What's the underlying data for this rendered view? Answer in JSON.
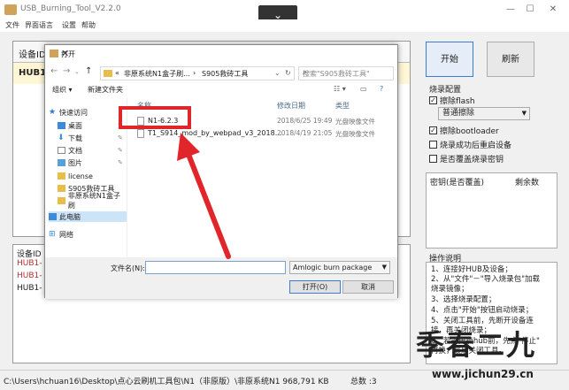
{
  "app": {
    "title": "USB_Burning_Tool_V2.2.0",
    "collapse_icon": "⌄",
    "min_icon": "—",
    "max_icon": "☐",
    "close_icon": "✕"
  },
  "menu": [
    "文件",
    "界面语言",
    "设置",
    "帮助"
  ],
  "device_panel": {
    "header": "设备ID",
    "row1": "HUB1"
  },
  "log_panel": {
    "header": "设备ID",
    "lines": [
      {
        "text": "HUB1-",
        "color": "#b03030"
      },
      {
        "text": "HUB1-",
        "color": "#b03030"
      },
      {
        "text": "HUB1-",
        "color": "#222222"
      }
    ]
  },
  "buttons": {
    "start": "开始",
    "refresh": "刷新"
  },
  "burn_config": {
    "title": "烧录配置",
    "erase_flash": "擦除flash",
    "erase_mode": "普通擦除",
    "erase_bootloader": "擦除bootloader",
    "reboot_after": "烧录成功后重启设备",
    "overwrite_key": "是否覆盖烧录密钥"
  },
  "key_panel": {
    "col1": "密钥(是否覆盖)",
    "col2": "剩余数"
  },
  "ops": {
    "title": "操作说明",
    "lines": [
      "1、连接好HUB及设备；",
      "2、从\"文件\"－\"导入烧录包\"加载",
      "烧录镜像；",
      "3、选择烧录配置；",
      "4、点击\"开始\"按钮启动烧录；",
      "5、关闭工具前，先断开设备连",
      "接，再关闭烧录；",
      "6、若需更换hub前，先点\"停止\"",
      "再换，最后关闭工具。"
    ]
  },
  "status": {
    "path": "C:\\Users\\hchuan16\\Desktop\\点心云刷机工具包\\N1（非原版）\\非原系统N1 968,791 KB",
    "total": "总数 :3"
  },
  "dialog": {
    "title": "打开",
    "close_icon": "✕",
    "address": [
      "«",
      "非原系统N1盒子刷...",
      "›",
      "S905救砖工具"
    ],
    "search_placeholder": "搜索\"S905救砖工具\"",
    "toolbar": {
      "organize": "组织 ▾",
      "new_folder": "新建文件夹"
    },
    "nav": [
      {
        "label": "快速访问",
        "icon": "star",
        "color": "#2a7ad6"
      },
      {
        "label": "桌面",
        "icon": "desktop",
        "color": "#3d8bd8",
        "pin": true
      },
      {
        "label": "下载",
        "icon": "download",
        "color": "#3d8bd8",
        "pin": true
      },
      {
        "label": "文档",
        "icon": "doc",
        "color": "#8a8a8a",
        "pin": true
      },
      {
        "label": "图片",
        "icon": "pic",
        "color": "#5aa0d8",
        "pin": true
      },
      {
        "label": "license",
        "icon": "folder",
        "color": "#e8bd4a"
      },
      {
        "label": "S905救砖工具",
        "icon": "folder",
        "color": "#e8bd4a"
      },
      {
        "label": "非原系统N1盒子刷",
        "icon": "folder",
        "color": "#e8bd4a"
      },
      {
        "label": "此电脑",
        "icon": "pc",
        "color": "#3d8bd8"
      },
      {
        "label": "网络",
        "icon": "net",
        "color": "#3d8bd8"
      }
    ],
    "columns": {
      "name": "名称",
      "date": "修改日期",
      "type": "类型"
    },
    "files": [
      {
        "name": "N1-6.2.3",
        "date": "2018/6/25 19:49",
        "type": "光盘映像文件"
      },
      {
        "name": "T1_S914_mod_by_webpad_v3_2018...",
        "date": "2018/4/19 21:05",
        "type": "光盘映像文件"
      }
    ],
    "filename_label": "文件名(N):",
    "filename_value": "",
    "filetype": "Amlogic burn package (*.img",
    "open_btn": "打开(O)",
    "cancel_btn": "取消"
  },
  "watermark": {
    "text": "季春二九",
    "url": "www.jichun29.cn"
  },
  "colors": {
    "highlight": "#e0262a",
    "accent": "#3d7bd6"
  }
}
